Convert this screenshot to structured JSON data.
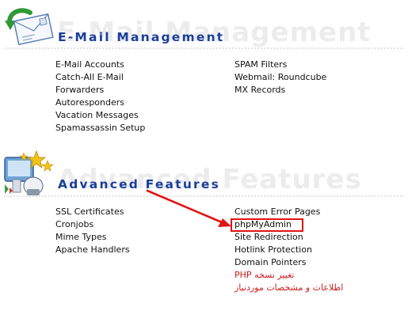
{
  "email": {
    "watermark": "E-Mail Management",
    "title": "E-Mail Management",
    "left_links": [
      "E-Mail Accounts",
      "Catch-All E-Mail",
      "Forwarders",
      "Autoresponders",
      "Vacation Messages",
      "Spamassassin Setup"
    ],
    "right_links": [
      "SPAM Filters",
      "Webmail: Roundcube",
      "MX Records"
    ]
  },
  "advanced": {
    "watermark": "Advanced Features",
    "title": "Advanced Features",
    "left_links": [
      "SSL Certificates",
      "Cronjobs",
      "Mime Types",
      "Apache Handlers"
    ],
    "right_links": [
      "Custom Error Pages",
      "phpMyAdmin",
      "Site Redirection",
      "Hotlink Protection",
      "Domain Pointers"
    ],
    "rtl_links": [
      "PHP تغییر نسخه",
      "اطلاعات و مشخصات موردنیاز"
    ]
  },
  "annotation": {
    "highlight_color": "#e01414",
    "highlighted_item": "phpMyAdmin"
  },
  "colors": {
    "heading": "#1b3f9c",
    "link": "#111111",
    "rtl_link": "#cc1c1c"
  },
  "icons": {
    "email": "envelope-refresh-icon",
    "advanced": "settings-stars-icon"
  }
}
